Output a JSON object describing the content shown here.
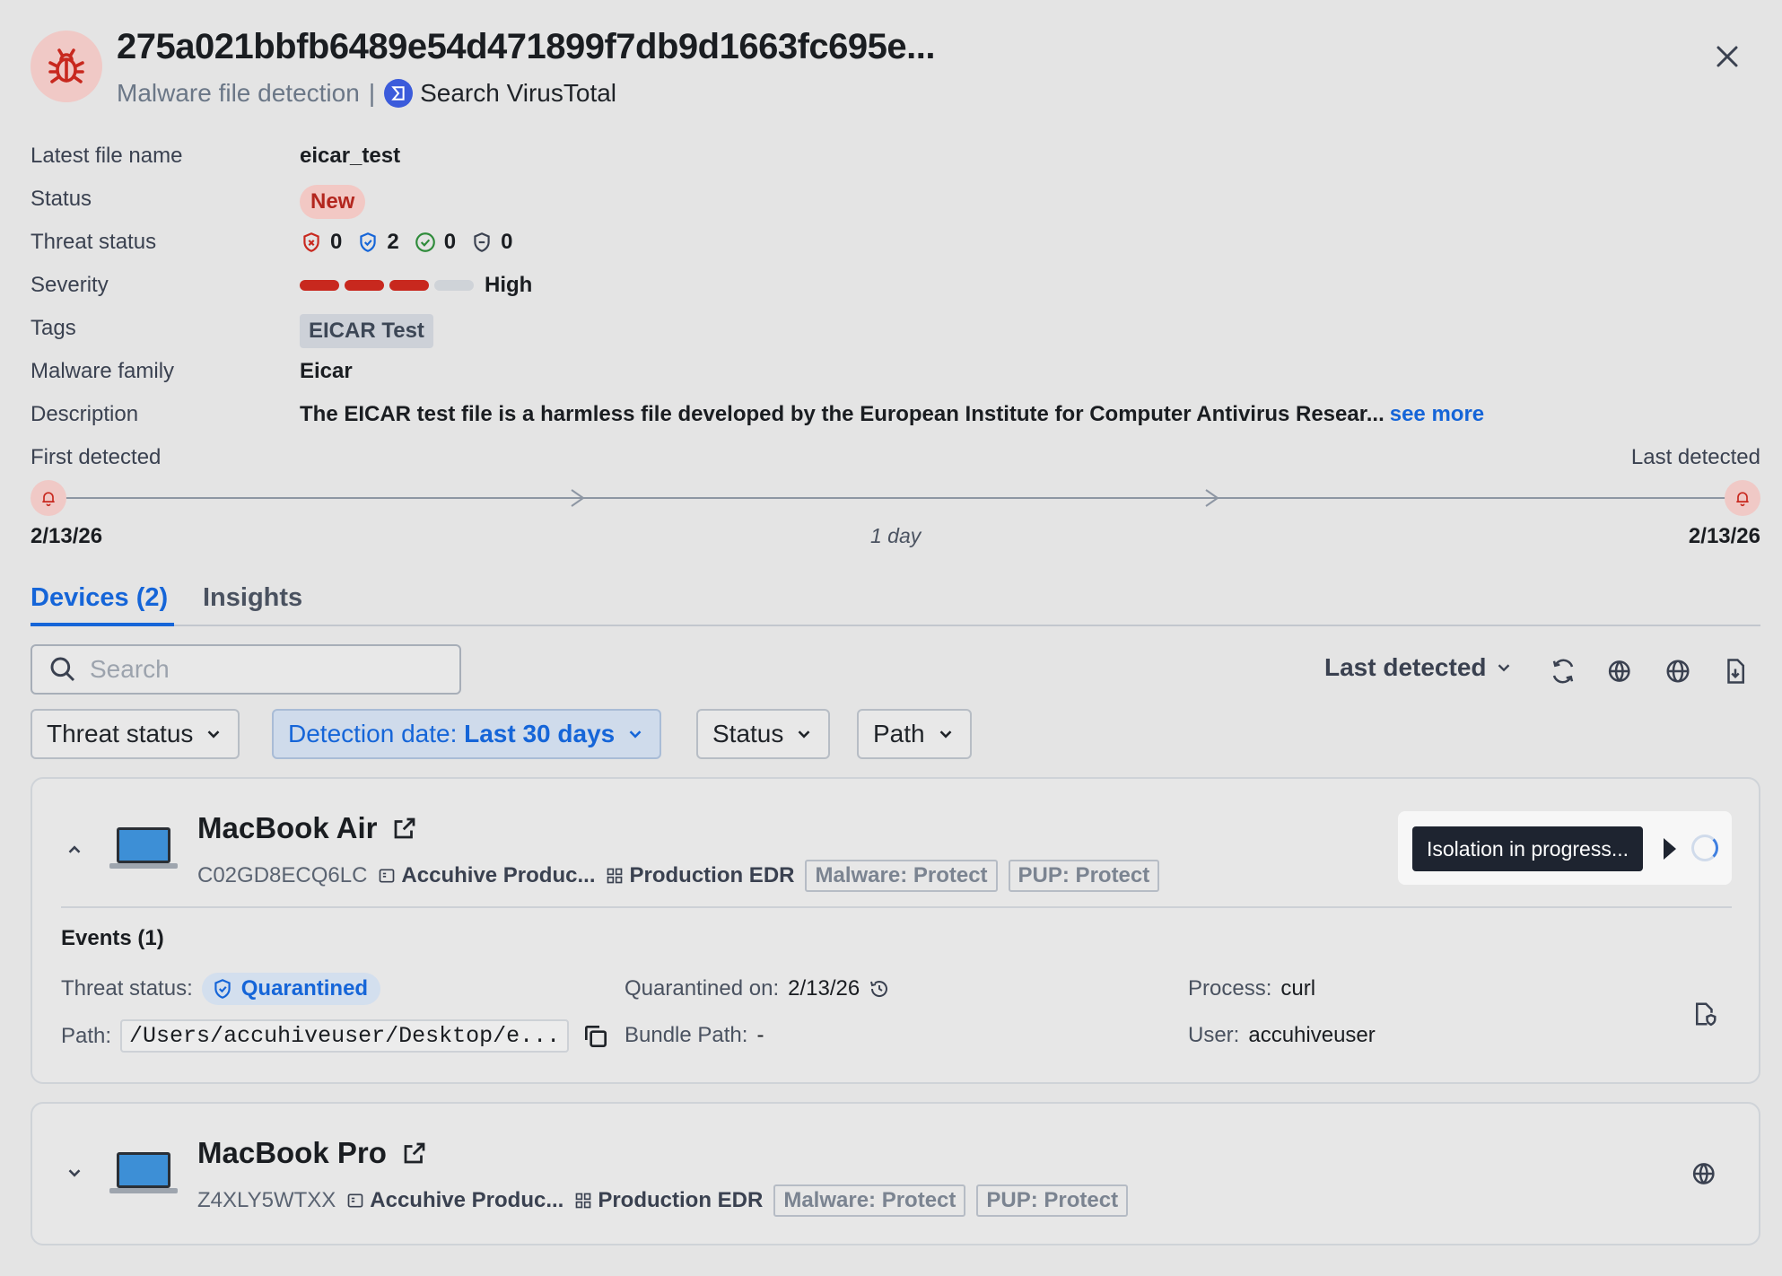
{
  "header": {
    "title": "275a021bbfb6489e54d471899f7db9d1663fc695e...",
    "subtitle": "Malware file detection",
    "separator": "|",
    "virustotal_label": "Search VirusTotal"
  },
  "details": {
    "latest_file_name": {
      "label": "Latest file name",
      "value": "eicar_test"
    },
    "status": {
      "label": "Status",
      "value": "New"
    },
    "threat_status": {
      "label": "Threat status",
      "counts": [
        "0",
        "2",
        "0",
        "0"
      ]
    },
    "severity": {
      "label": "Severity",
      "level": 3,
      "max": 4,
      "value": "High"
    },
    "tags": {
      "label": "Tags",
      "values": [
        "EICAR Test"
      ]
    },
    "malware_family": {
      "label": "Malware family",
      "value": "Eicar"
    },
    "description": {
      "label": "Description",
      "value": "The EICAR test file is a harmless file developed by the European Institute for Computer Antivirus Resear...",
      "more": "see more"
    }
  },
  "timeline": {
    "first_label": "First detected",
    "last_label": "Last detected",
    "first_date": "2/13/26",
    "last_date": "2/13/26",
    "duration": "1 day"
  },
  "tabs": [
    {
      "label": "Devices (2)",
      "active": true
    },
    {
      "label": "Insights",
      "active": false
    }
  ],
  "toolbar": {
    "search_placeholder": "Search",
    "sort_label": "Last detected"
  },
  "filters": {
    "threat_status": "Threat status",
    "detection_prefix": "Detection date:",
    "detection_value": "Last 30 days",
    "status": "Status",
    "path": "Path"
  },
  "devices": [
    {
      "name": "MacBook Air",
      "serial": "C02GD8ECQ6LC",
      "org": "Accuhive Produc...",
      "plan": "Production EDR",
      "chips": [
        "Malware: Protect",
        "PUP: Protect"
      ],
      "isolation": "Isolation in progress...",
      "events_title": "Events (1)",
      "event": {
        "threat_status_label": "Threat status:",
        "threat_status_value": "Quarantined",
        "path_label": "Path:",
        "path_value": "/Users/accuhiveuser/Desktop/e...",
        "quarantined_label": "Quarantined on:",
        "quarantined_value": "2/13/26",
        "bundle_label": "Bundle Path:",
        "bundle_value": "-",
        "process_label": "Process:",
        "process_value": "curl",
        "user_label": "User:",
        "user_value": "accuhiveuser"
      }
    },
    {
      "name": "MacBook Pro",
      "serial": "Z4XLY5WTXX",
      "org": "Accuhive Produc...",
      "plan": "Production EDR",
      "chips": [
        "Malware: Protect",
        "PUP: Protect"
      ]
    }
  ],
  "colors": {
    "accent": "#1565d8",
    "danger": "#c8281e",
    "background": "#e4e4e4"
  }
}
